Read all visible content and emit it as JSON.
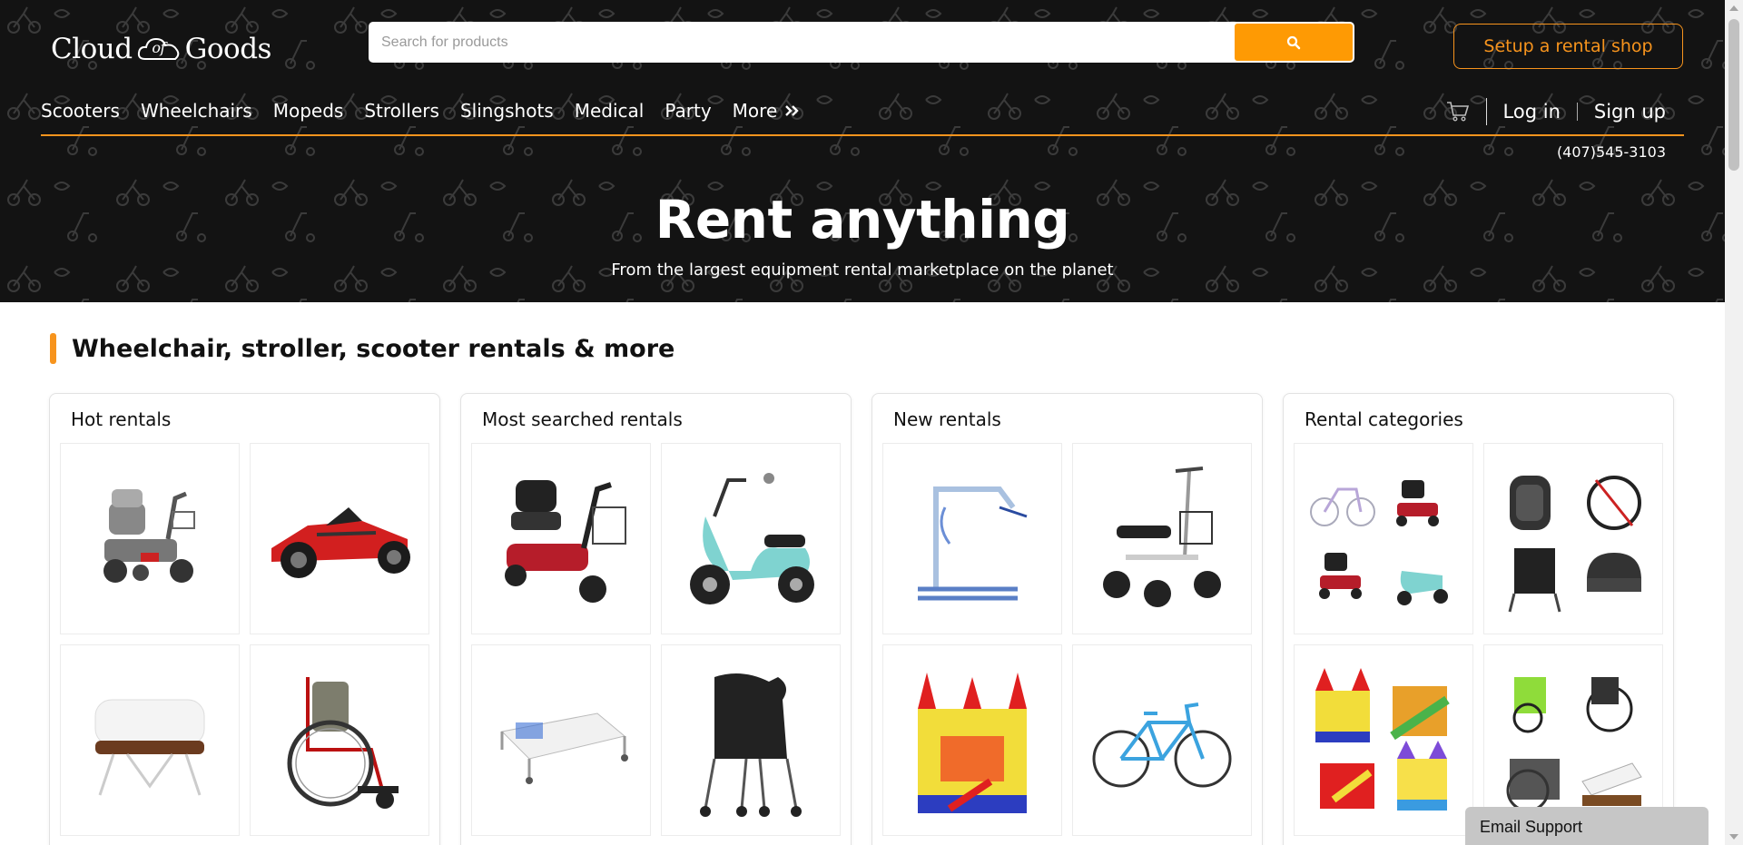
{
  "logo": {
    "left": "Cloud",
    "middle": "of",
    "right": "Goods"
  },
  "search": {
    "placeholder": "Search for products",
    "button_icon": "search-icon"
  },
  "setup_button": "Setup a rental shop",
  "nav": {
    "items": [
      "Scooters",
      "Wheelchairs",
      "Mopeds",
      "Strollers",
      "Slingshots",
      "Medical",
      "Party"
    ],
    "more": "More"
  },
  "user": {
    "cart_icon": "cart-icon",
    "login": "Log in",
    "signup": "Sign up"
  },
  "phone": "(407)545-3103",
  "hero": {
    "title": "Rent anything",
    "subtitle": "From the largest equipment rental marketplace on the planet"
  },
  "section_title": "Wheelchair, stroller, scooter rentals & more",
  "cards": [
    {
      "title": "Hot rentals",
      "tiles": [
        "mobility-scooter",
        "slingshot-vehicle",
        "bassinet",
        "wheelchair"
      ]
    },
    {
      "title": "Most searched rentals",
      "tiles": [
        "mobility-scooter-red",
        "moped-teal",
        "hospital-bed",
        "double-stroller"
      ]
    },
    {
      "title": "New rentals",
      "tiles": [
        "patient-lift",
        "knee-scooter",
        "bounce-house",
        "bicycle"
      ]
    },
    {
      "title": "Rental categories",
      "tiles": [
        "category-scooters",
        "category-strollers",
        "category-party",
        "category-medical"
      ]
    }
  ],
  "email_support": "Email Support",
  "colors": {
    "accent": "#f7941d",
    "search_button": "#fe9a04",
    "hero_bg": "#131313"
  }
}
